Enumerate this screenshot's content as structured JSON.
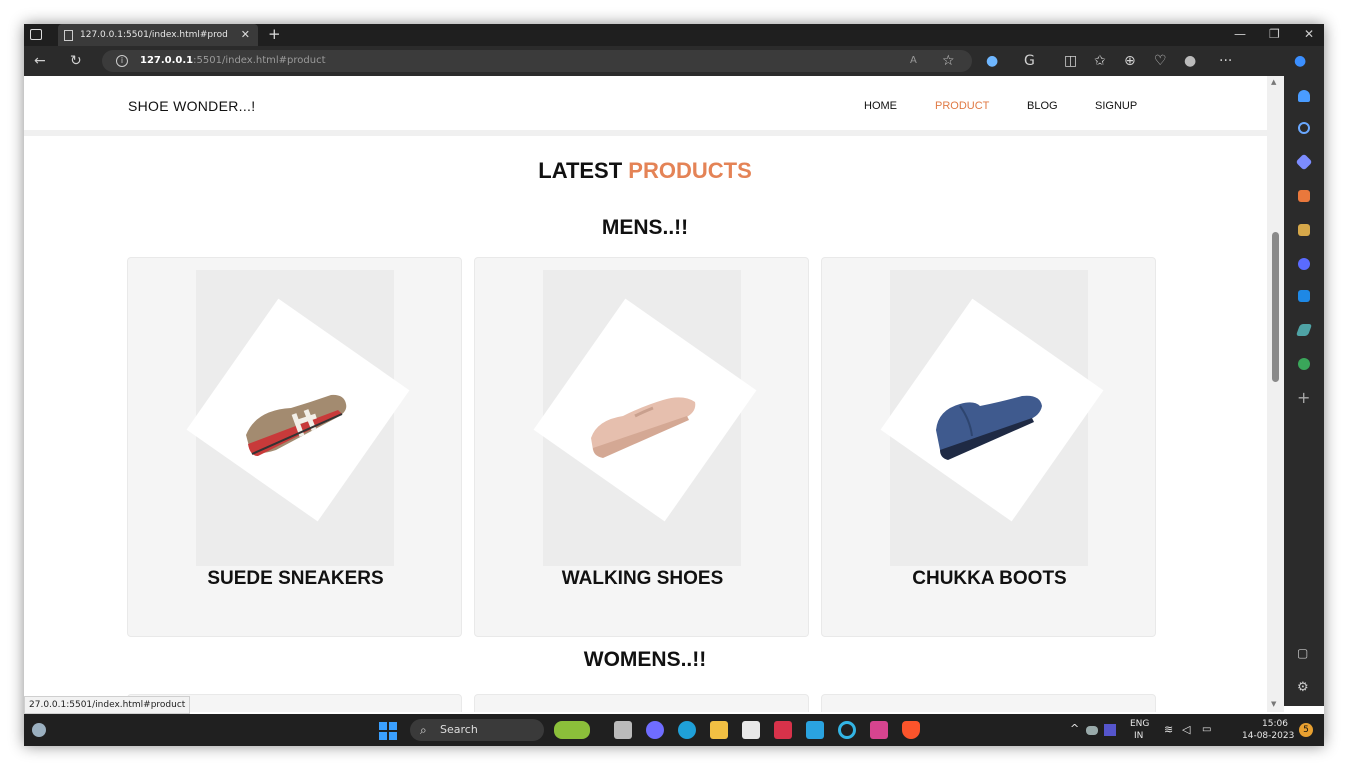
{
  "browser": {
    "tab_title": "127.0.0.1:5501/index.html#prod",
    "tab_close": "✕",
    "new_tab": "+",
    "address_host": "127.0.0.1",
    "address_path": ":5501/index.html#product",
    "status_url": "27.0.0.1:5501/index.html#product"
  },
  "site": {
    "brand": "SHOE WONDER...!",
    "nav": [
      {
        "label": "HOME"
      },
      {
        "label": "PRODUCT"
      },
      {
        "label": "BLOG"
      },
      {
        "label": "SIGNUP"
      }
    ],
    "active_nav": "PRODUCT",
    "heading_main": "LATEST",
    "heading_accent": "PRODUCTS",
    "mens_title": "MENS..!!",
    "womens_title": "WOMENS..!!",
    "mens_products": [
      {
        "name": "SUEDE SNEAKERS"
      },
      {
        "name": "WALKING SHOES"
      },
      {
        "name": "CHUKKA BOOTS"
      }
    ]
  },
  "taskbar": {
    "search_label": "Search",
    "lang_top": "ENG",
    "lang_bottom": "IN",
    "time": "15:06",
    "date": "14-08-2023",
    "notif_count": "5"
  },
  "colors": {
    "accent": "#e07a45",
    "tabbar": "#1f1f1f",
    "toolbar": "#2b2b2b",
    "card_bg": "#f5f5f5"
  }
}
